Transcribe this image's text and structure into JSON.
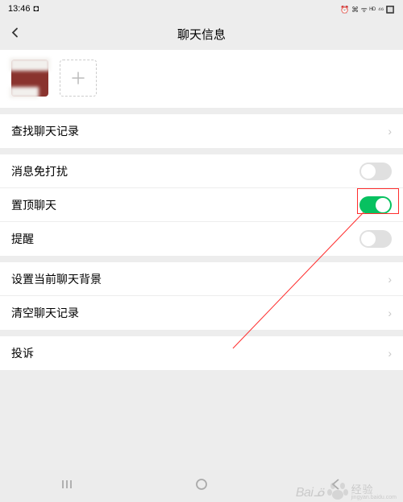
{
  "status": {
    "time": "13:46",
    "icon": "◘",
    "right": "⏰ ⌘ ᯤ ᴴᴰ ⁴⁶ 🔲"
  },
  "header": {
    "title": "聊天信息"
  },
  "rows": {
    "search": "查找聊天记录",
    "mute": "消息免打扰",
    "sticky": "置顶聊天",
    "remind": "提醒",
    "background": "设置当前聊天背景",
    "clear": "清空聊天记录",
    "complaint": "投诉"
  },
  "toggles": {
    "mute": "off",
    "sticky": "on",
    "remind": "off"
  },
  "watermark": {
    "brand": "Baiᓆ",
    "cn": "经验",
    "en": "jingyan.baidu.com"
  }
}
